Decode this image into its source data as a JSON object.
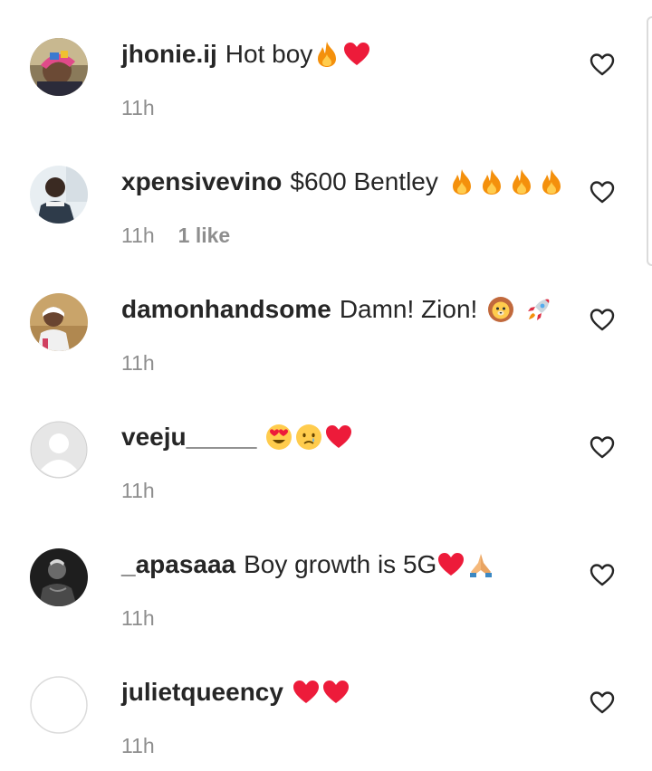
{
  "comments": [
    {
      "username": "jhonie.ij",
      "text": "Hot boy",
      "emojis": [
        "fire-emoji",
        "red-heart-emoji"
      ],
      "time": "11h",
      "likes": ""
    },
    {
      "username": "xpensivevino",
      "text": "$600 Bentley",
      "emojis": [
        "fire-emoji",
        "fire-emoji",
        "fire-emoji",
        "fire-emoji"
      ],
      "time": "11h",
      "likes": "1 like"
    },
    {
      "username": "damonhandsome",
      "text": "Damn! Zion!",
      "emojis": [
        "lion-emoji",
        "rocket-emoji"
      ],
      "time": "11h",
      "likes": ""
    },
    {
      "username": "veeju_____",
      "text": "",
      "emojis": [
        "heart-eyes-emoji",
        "crying-face-emoji",
        "red-heart-emoji"
      ],
      "time": "11h",
      "likes": ""
    },
    {
      "username": "_apasaaa",
      "text": "Boy growth is 5G",
      "emojis": [
        "red-heart-emoji",
        "folded-hands-emoji"
      ],
      "time": "11h",
      "likes": ""
    },
    {
      "username": "julietqueency",
      "text": "",
      "emojis": [
        "red-heart-emoji",
        "red-heart-emoji"
      ],
      "time": "11h",
      "likes": ""
    }
  ],
  "icons": {
    "like": "heart-outline-icon"
  },
  "colors": {
    "text": "#262626",
    "secondary": "#8e8e8e",
    "heart": "#ed1b3a",
    "fire": "#f4900c"
  }
}
